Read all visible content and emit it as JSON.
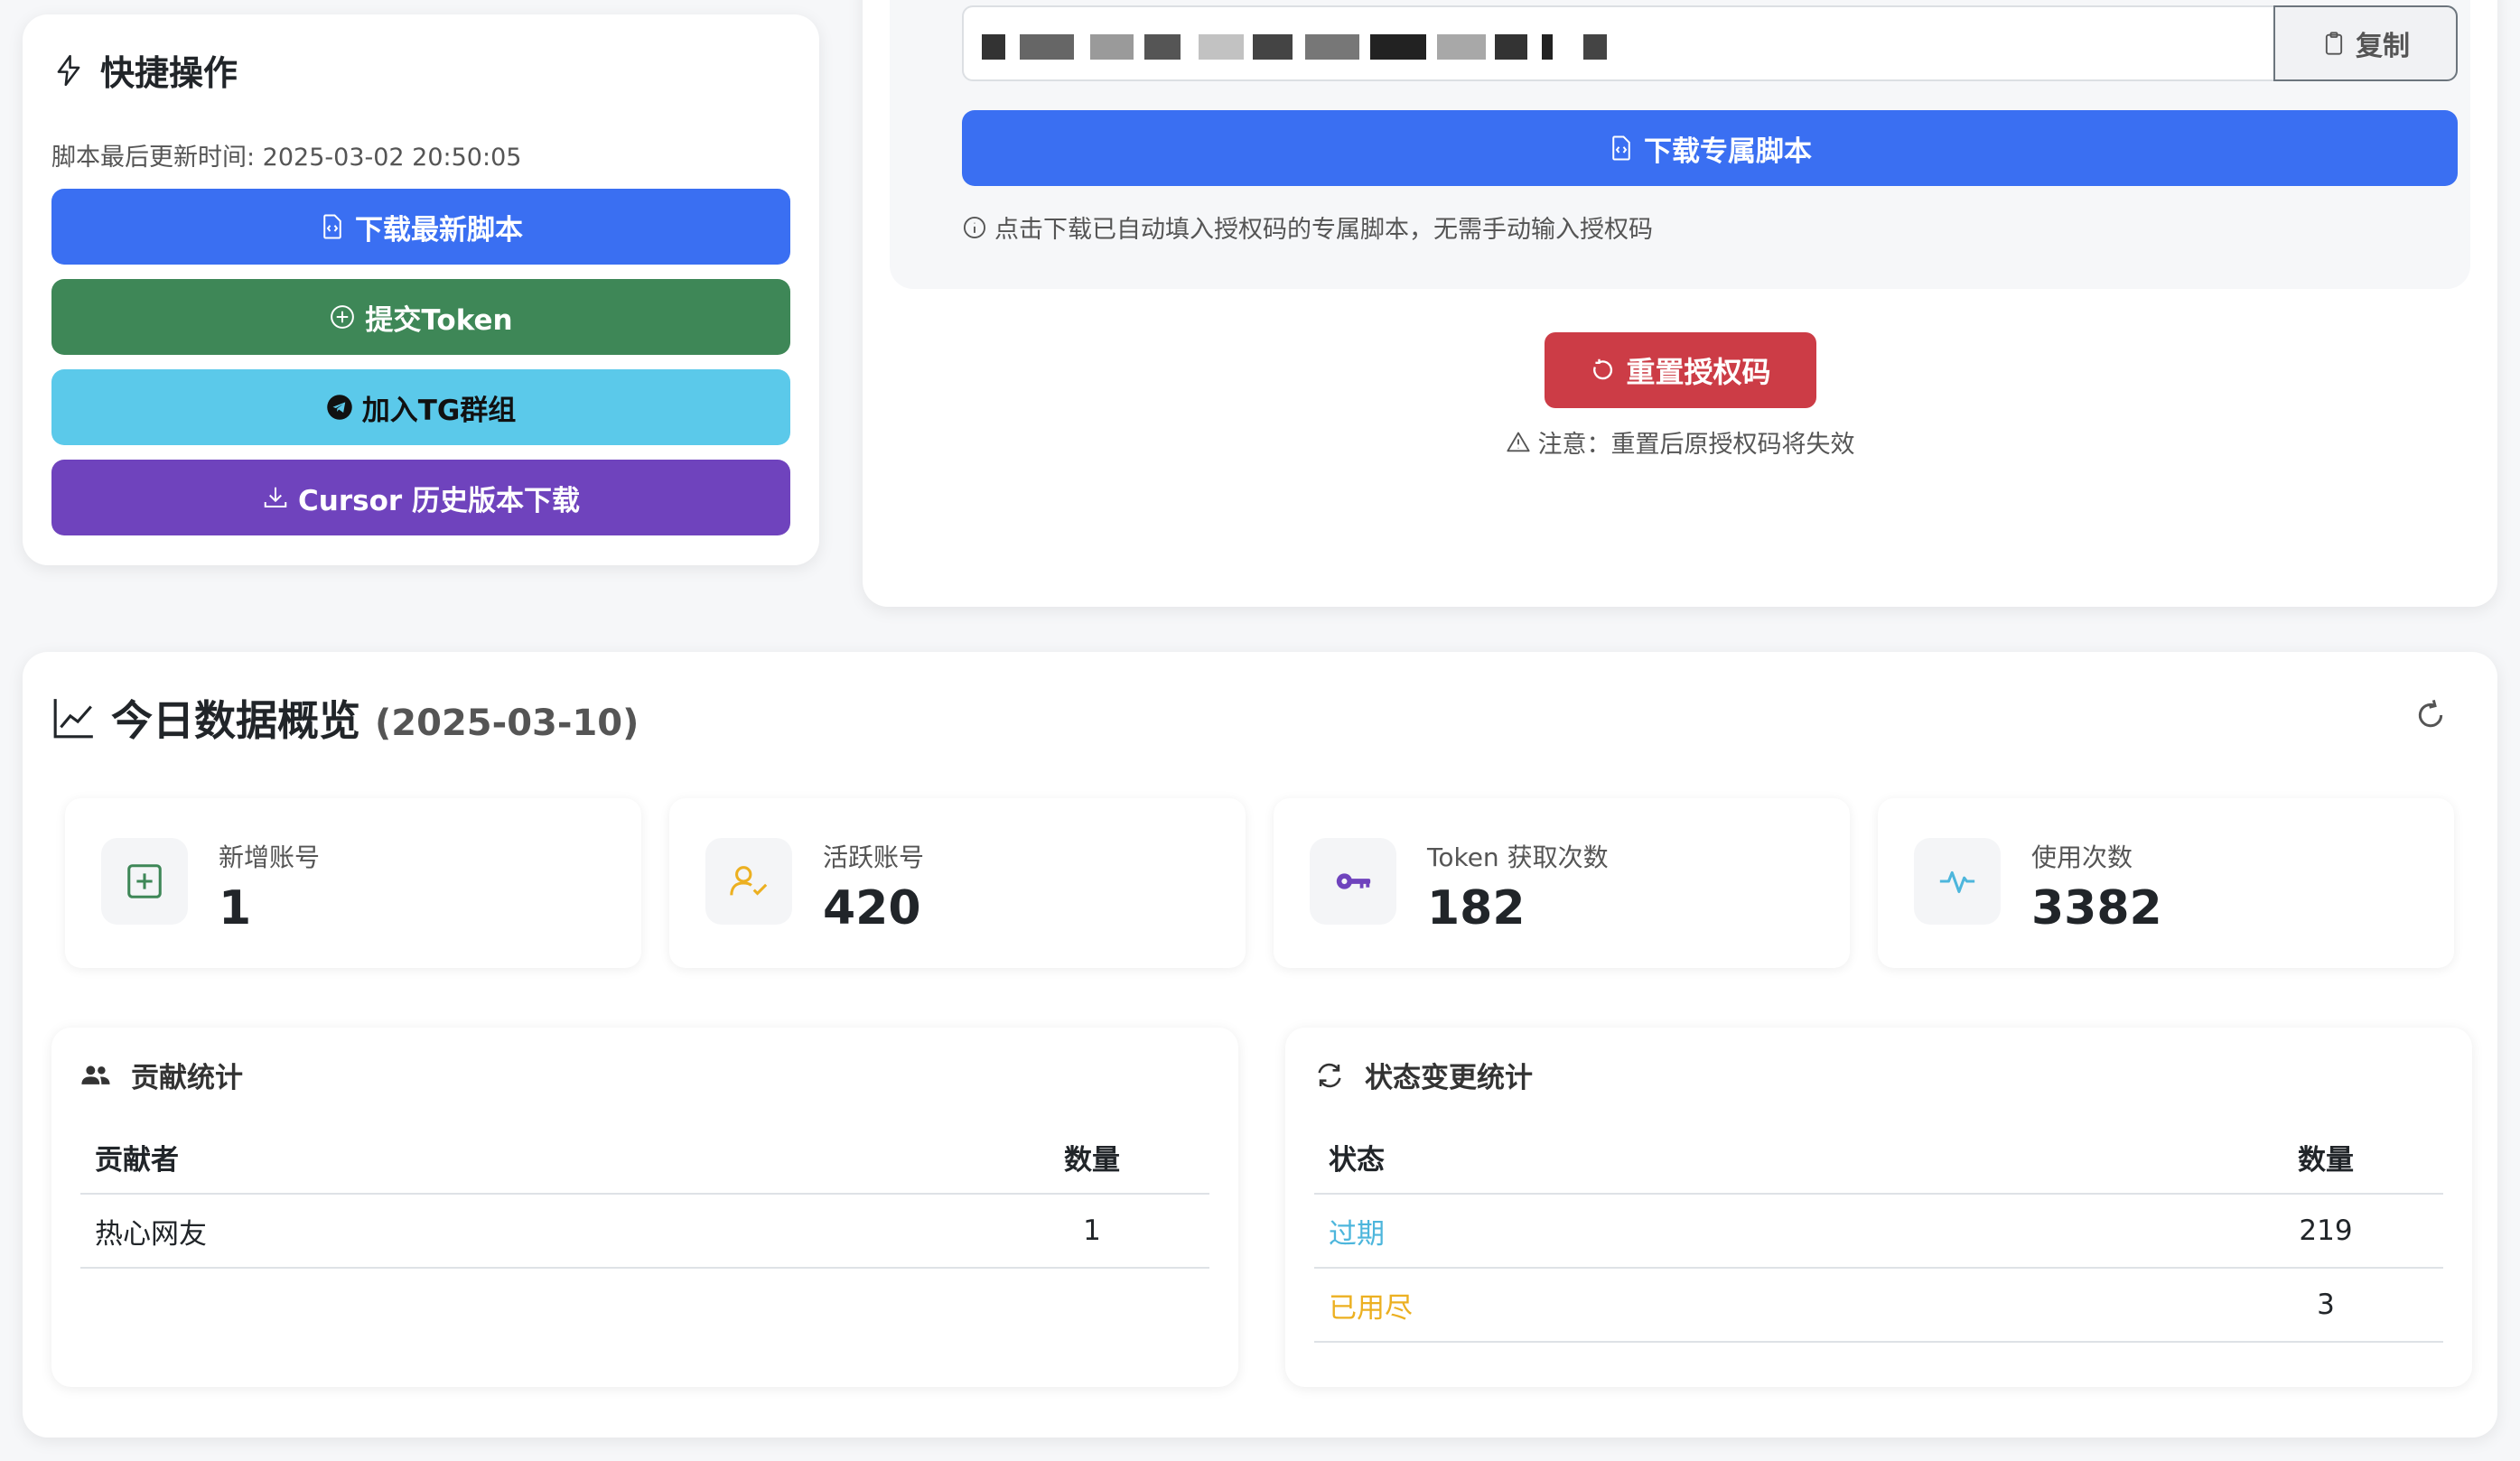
{
  "quick_actions": {
    "title": "快捷操作",
    "last_updated": "脚本最后更新时间: 2025-03-02 20:50:05",
    "buttons": {
      "download_latest": "下载最新脚本",
      "submit_token": "提交Token",
      "join_tg": "加入TG群组",
      "cursor_history": "Cursor 历史版本下载"
    }
  },
  "auth": {
    "copy_label": "复制",
    "download_exclusive": "下载专属脚本",
    "hint": "点击下载已自动填入授权码的专属脚本，无需手动输入授权码",
    "reset_label": "重置授权码",
    "reset_warning": "注意：重置后原授权码将失效"
  },
  "overview": {
    "title": "今日数据概览",
    "date": "(2025-03-10)",
    "metrics": [
      {
        "label": "新增账号",
        "value": "1",
        "icon": "plus-square-icon",
        "color": "#3e8757"
      },
      {
        "label": "活跃账号",
        "value": "420",
        "icon": "user-check-icon",
        "color": "#ecb021"
      },
      {
        "label": "Token 获取次数",
        "value": "182",
        "icon": "key-icon",
        "color": "#6f43bd"
      },
      {
        "label": "使用次数",
        "value": "3382",
        "icon": "activity-icon",
        "color": "#4db6dc"
      }
    ]
  },
  "contribution": {
    "title": "贡献统计",
    "headers": [
      "贡献者",
      "数量"
    ],
    "rows": [
      {
        "name": "热心网友",
        "count": "1"
      }
    ]
  },
  "status_changes": {
    "title": "状态变更统计",
    "headers": [
      "状态",
      "数量"
    ],
    "rows": [
      {
        "status": "过期",
        "count": "219"
      },
      {
        "status": "已用尽",
        "count": "3"
      }
    ]
  }
}
